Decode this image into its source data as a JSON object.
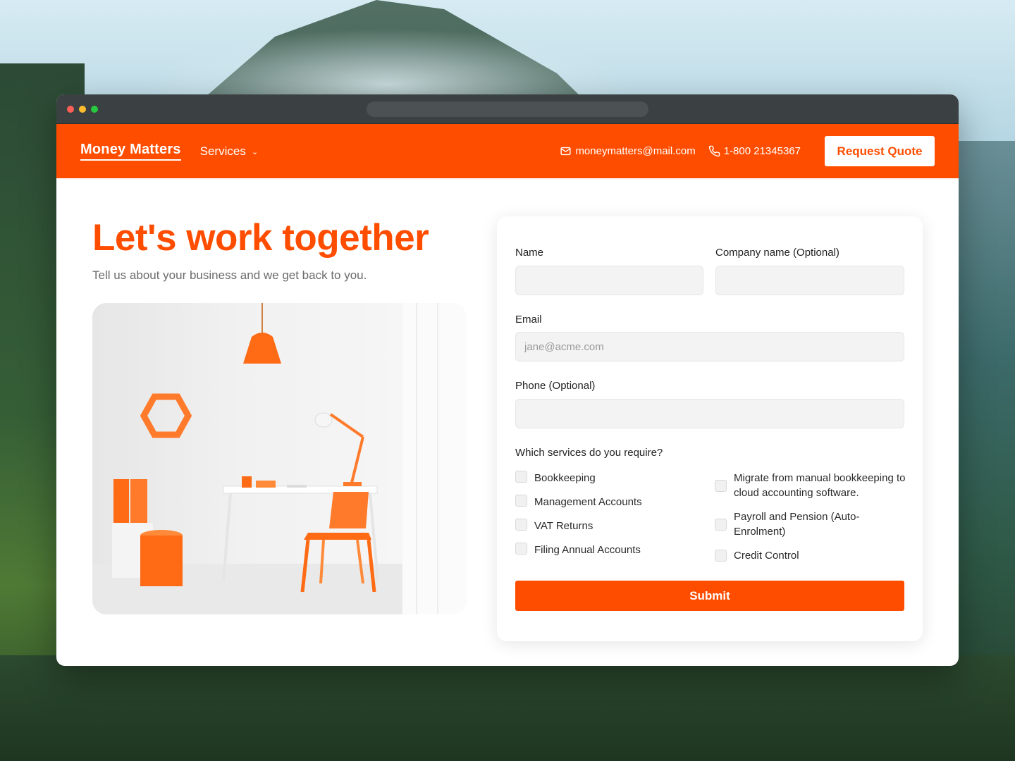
{
  "brand": {
    "name": "Money Matters",
    "accent": "#ff4d00"
  },
  "nav": {
    "services_label": "Services",
    "email": "moneymatters@mail.com",
    "phone": "1-800 21345367",
    "quote_button": "Request Quote"
  },
  "hero": {
    "headline": "Let's work together",
    "subline": "Tell us about your business and we get back to you."
  },
  "form": {
    "name_label": "Name",
    "company_label": "Company name (Optional)",
    "email_label": "Email",
    "email_placeholder": "jane@acme.com",
    "phone_label": "Phone (Optional)",
    "services_question": "Which services do you require?",
    "services_left": [
      "Bookkeeping",
      "Management Accounts",
      "VAT Returns",
      "Filing Annual Accounts"
    ],
    "services_right": [
      "Migrate from manual bookkeeping to cloud accounting software.",
      "Payroll and Pension (Auto-Enrolment)",
      "Credit Control"
    ],
    "submit_label": "Submit"
  }
}
